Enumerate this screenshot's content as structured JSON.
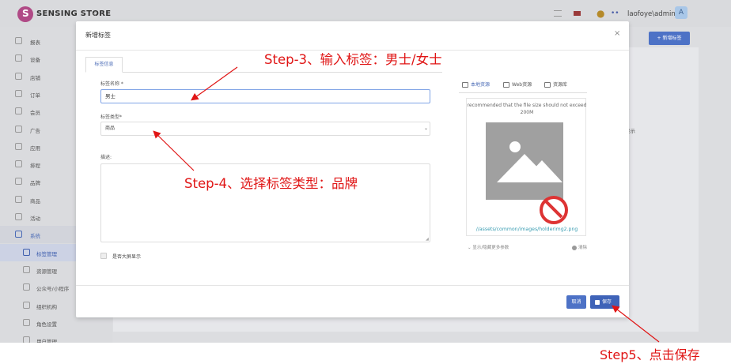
{
  "app": {
    "brand": "SENSING STORE",
    "user": "laofoye\\admin",
    "avatar_letter": "A"
  },
  "icons": {
    "logo": "s-logo-icon",
    "collapse": "chevron-left-icon",
    "menu": "menu-icon",
    "flag": "flag-icon",
    "notifications": "bell-icon",
    "dots": "more-dots-icon",
    "close": "close-icon"
  },
  "sidebar": {
    "items": [
      {
        "label": "报表",
        "icon": "report-icon"
      },
      {
        "label": "设备",
        "icon": "device-icon"
      },
      {
        "label": "店铺",
        "icon": "store-icon"
      },
      {
        "label": "订单",
        "icon": "order-icon"
      },
      {
        "label": "会员",
        "icon": "member-icon"
      },
      {
        "label": "广告",
        "icon": "ad-icon"
      },
      {
        "label": "应用",
        "icon": "app-icon"
      },
      {
        "label": "排程",
        "icon": "schedule-icon"
      },
      {
        "label": "品牌",
        "icon": "brand-icon"
      },
      {
        "label": "商品",
        "icon": "product-icon"
      },
      {
        "label": "活动",
        "icon": "activity-icon"
      },
      {
        "label": "系统",
        "icon": "system-icon"
      }
    ],
    "sub_items": [
      {
        "label": "标签管理",
        "icon": "tag-icon"
      },
      {
        "label": "资源管理",
        "icon": "resource-icon"
      },
      {
        "label": "公众号/小程序",
        "icon": "wechat-icon"
      },
      {
        "label": "组织机构",
        "icon": "org-icon"
      },
      {
        "label": "角色设置",
        "icon": "role-icon"
      },
      {
        "label": "用户管理",
        "icon": "user-icon"
      }
    ]
  },
  "background": {
    "add_button": "+ 新增标签",
    "column_text": "显示"
  },
  "modal": {
    "title": "新增标签",
    "tab": "标签信息",
    "name_label": "标签名称 *",
    "name_value": "男士",
    "type_label": "标签类型*",
    "type_value": "商品",
    "desc_label": "描述:",
    "bigscreen_label": "是否大屏显示",
    "image_tabs": [
      "本地资源",
      "Web资源",
      "资源库"
    ],
    "image_note": "recommended that the file size should not exceed 200M",
    "image_path": "//assets/common/images/holderimg2.png",
    "more_params": "显示/隐藏更多参数",
    "clear": "清除",
    "cancel": "取消",
    "save": "保存"
  },
  "annotations": {
    "step3": "Step-3、输入标签：男士/女士",
    "step4": "Step-4、选择标签类型：品牌",
    "step5": "Step5、点击保存"
  },
  "colors": {
    "accent": "#4d72c6",
    "annotation": "#e01515"
  }
}
